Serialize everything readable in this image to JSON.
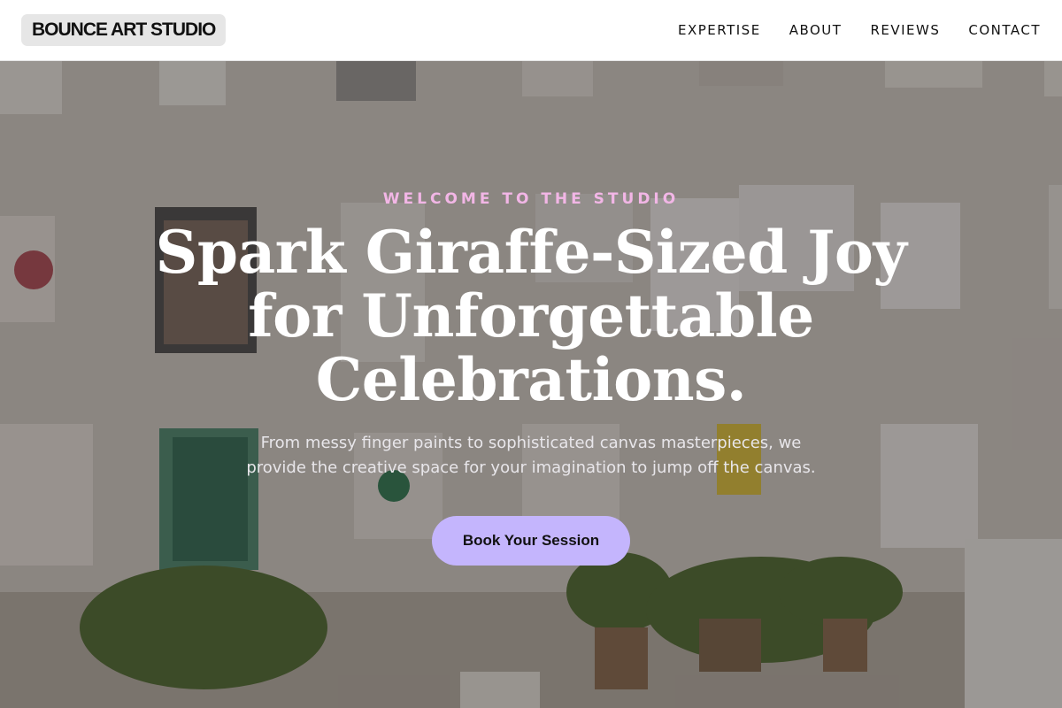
{
  "header": {
    "logo": "BOUNCE ART STUDIO",
    "nav": [
      "EXPERTISE",
      "ABOUT",
      "REVIEWS",
      "CONTACT"
    ]
  },
  "hero": {
    "eyebrow": "WELCOME TO THE STUDIO",
    "headline": "Spark Giraffe-Sized Joy for Unforgettable Celebrations.",
    "subtext": "From messy finger paints to sophisticated canvas masterpieces, we provide the creative space for your imagination to jump off the canvas.",
    "cta": "Book Your Session"
  },
  "colors": {
    "accent": "#c4b5fd",
    "eyebrow": "#f2b6e6",
    "logo_bg": "#e6e6e6"
  }
}
